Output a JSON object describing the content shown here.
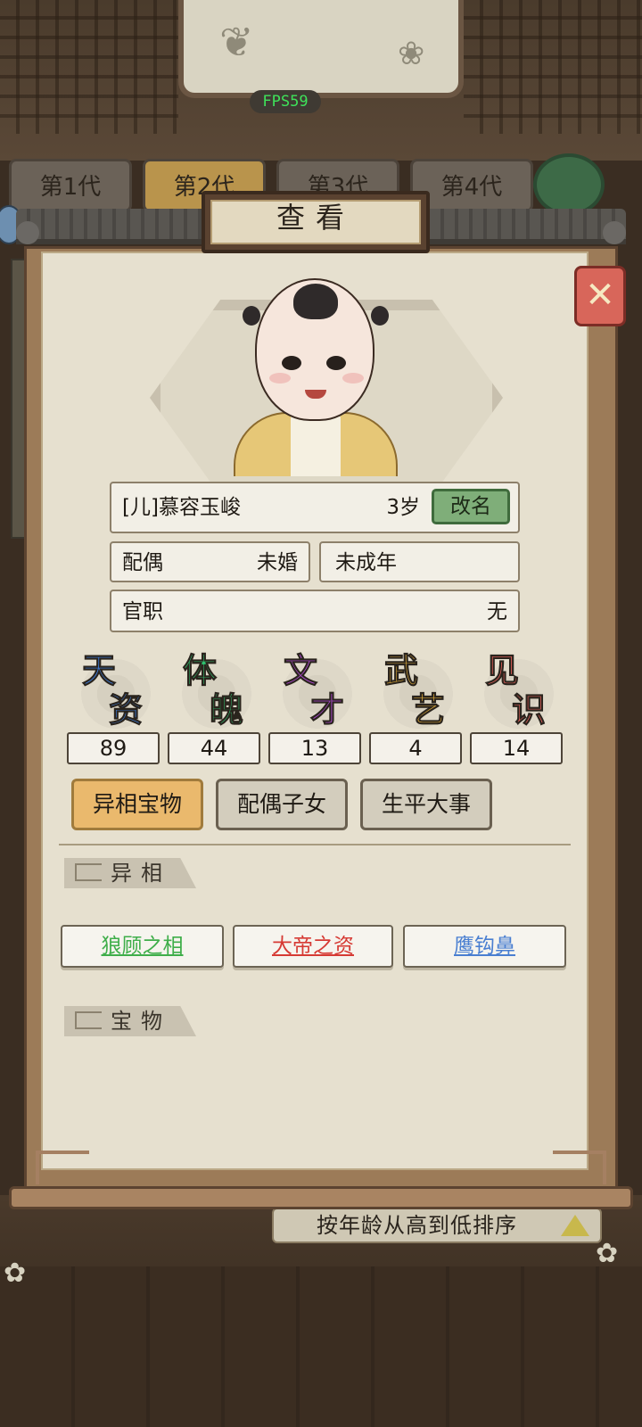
{
  "hud": {
    "fps": "FPS59"
  },
  "background": {
    "generation_tabs": [
      "第1代",
      "第2代",
      "第3代",
      "第4代"
    ],
    "active_generation_index": 1,
    "sort_label": "按年龄从高到低排序"
  },
  "modal": {
    "title": "查看",
    "profile": {
      "name": "[儿]慕容玉峻",
      "age": "3岁",
      "rename_label": "改名",
      "spouse_label": "配偶",
      "spouse_value": "未婚",
      "status": "未成年",
      "office_label": "官职",
      "office_value": "无"
    },
    "stats": [
      {
        "chars": [
          "天",
          "资"
        ],
        "value": "89",
        "color": "#3d7fe0"
      },
      {
        "chars": [
          "体",
          "魄"
        ],
        "value": "44",
        "color": "#2fbf6e"
      },
      {
        "chars": [
          "文",
          "才"
        ],
        "value": "13",
        "color": "#b14bd6"
      },
      {
        "chars": [
          "武",
          "艺"
        ],
        "value": "4",
        "color": "#e9b23a"
      },
      {
        "chars": [
          "见",
          "识"
        ],
        "value": "14",
        "color": "#e8625c"
      }
    ],
    "tabs": [
      "异相宝物",
      "配偶子女",
      "生平大事"
    ],
    "active_tab_index": 0,
    "section_traits": "异相",
    "traits": [
      {
        "label": "狼顾之相",
        "color": "#3fae4a"
      },
      {
        "label": "大帝之资",
        "color": "#d63a34"
      },
      {
        "label": "鹰钩鼻",
        "color": "#4a7fd1"
      }
    ],
    "section_treasures": "宝物"
  }
}
